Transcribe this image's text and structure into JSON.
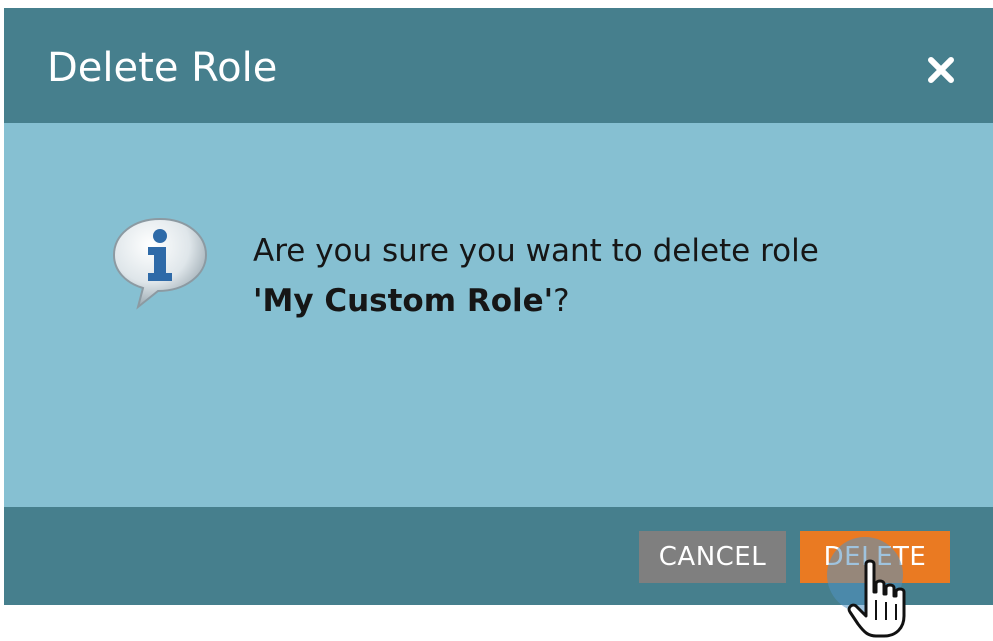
{
  "dialog": {
    "title": "Delete Role",
    "close_icon": "close-icon",
    "info_icon": "info-speech-bubble-icon",
    "message_prefix": "Are you sure you want to delete role",
    "role_name": "'My Custom Role'",
    "message_suffix": "?",
    "cancel_label": "CANCEL",
    "delete_label": "DELETE"
  },
  "colors": {
    "header_bg": "#467f8d",
    "body_bg": "#86c0d2",
    "footer_bg": "#467f8d",
    "cancel_bg": "#7f7f7f",
    "delete_bg": "#ea7a22"
  },
  "cursor": {
    "icon": "hand-pointer-icon"
  }
}
